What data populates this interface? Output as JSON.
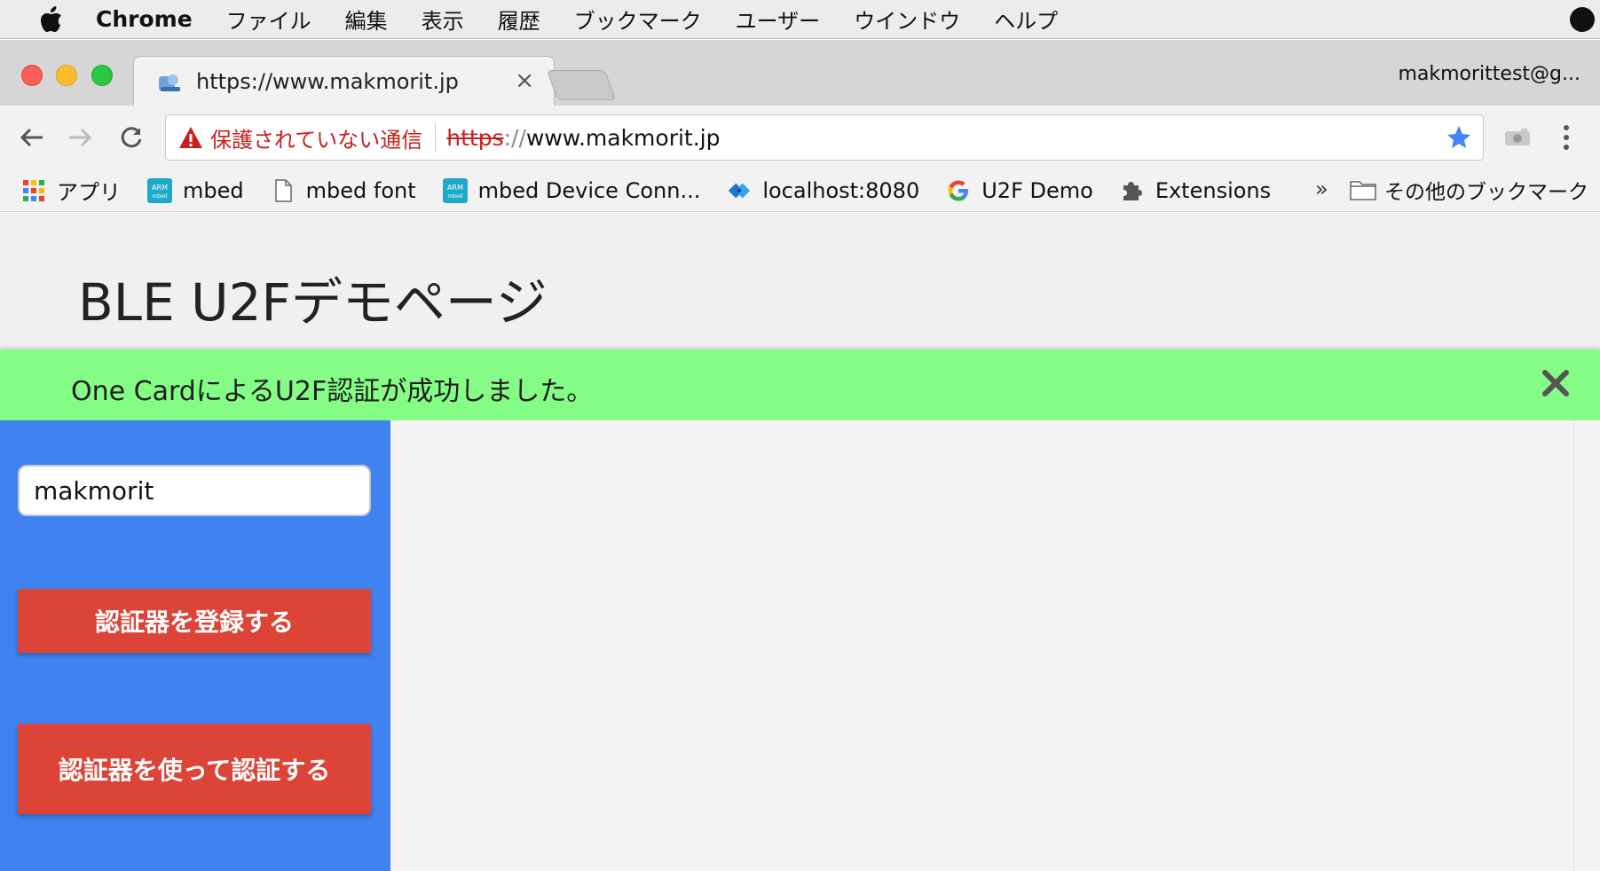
{
  "menubar": {
    "app_name": "Chrome",
    "items": [
      "ファイル",
      "編集",
      "表示",
      "履歴",
      "ブックマーク",
      "ユーザー",
      "ウインドウ",
      "ヘルプ"
    ]
  },
  "tab": {
    "title": "https://www.makmorit.jp",
    "close": "×"
  },
  "profile": "makmorittest@g...",
  "omnibox": {
    "security_label": "保護されていない通信",
    "scheme": "https",
    "separator": "://",
    "host": "www.makmorit.jp"
  },
  "bookmarks": {
    "items": [
      {
        "label": "アプリ",
        "icon": "apps-grid-icon"
      },
      {
        "label": "mbed",
        "icon": "arm-mbed-icon"
      },
      {
        "label": "mbed font",
        "icon": "page-icon"
      },
      {
        "label": "mbed Device Conn...",
        "icon": "arm-mbed-icon"
      },
      {
        "label": "localhost:8080",
        "icon": "diamond-icon"
      },
      {
        "label": "U2F Demo",
        "icon": "google-icon"
      },
      {
        "label": "Extensions",
        "icon": "puzzle-icon"
      }
    ],
    "more": "»",
    "other_label": "その他のブックマーク"
  },
  "page": {
    "title": "BLE U2Fデモページ",
    "alert_message": "One CardによるU2F認証が成功しました。",
    "username_value": "makmorit",
    "register_button": "認証器を登録する",
    "authenticate_button": "認証器を使って認証する"
  },
  "colors": {
    "alert_bg": "#84fc86",
    "sidebar_bg": "#3f82f0",
    "button_bg": "#db4437",
    "warning_red": "#c5221f",
    "star_blue": "#4285f4"
  }
}
